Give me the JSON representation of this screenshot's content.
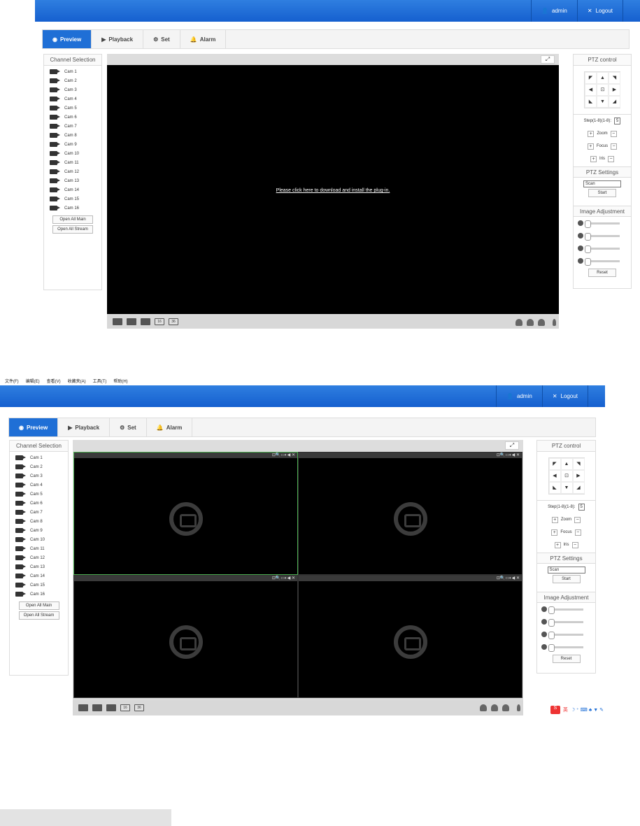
{
  "screen1": {
    "header": {
      "user_label": "admin",
      "logout_label": "Logout"
    },
    "tabs": [
      {
        "label": "Preview",
        "icon": "preview-icon",
        "active": true
      },
      {
        "label": "Playback",
        "icon": "playback-icon"
      },
      {
        "label": "Set",
        "icon": "gear-icon"
      },
      {
        "label": "Alarm",
        "icon": "bell-icon"
      }
    ],
    "channel_panel": {
      "title": "Channel Selection",
      "cams": [
        "Cam 1",
        "Cam 2",
        "Cam 3",
        "Cam 4",
        "Cam 5",
        "Cam 6",
        "Cam 7",
        "Cam 8",
        "Cam 9",
        "Cam 10",
        "Cam 11",
        "Cam 12",
        "Cam 13",
        "Cam 14",
        "Cam 15",
        "Cam 16"
      ],
      "open_all_main": "Open All Main",
      "open_all_stream": "Open All Stream"
    },
    "plugin_message": "Please click here to download and install the plug-in.",
    "ptz": {
      "title": "PTZ control",
      "step_label": "Step(1-8)(1-8):",
      "step_value": "5",
      "zoom_label": "Zoom",
      "focus_label": "Focus",
      "iris_label": "Iris"
    },
    "ptz_settings": {
      "title": "PTZ Settings",
      "mode": "Scan",
      "start_label": "Start"
    },
    "image_adjust": {
      "title": "Image Adjustment",
      "reset_label": "Reset"
    }
  },
  "screen2": {
    "menu": [
      "文件(F)",
      "编辑(E)",
      "查看(V)",
      "收藏夹(A)",
      "工具(T)",
      "帮助(H)"
    ],
    "tile_tools": "⊡🔍▭◐◀ ✕"
  },
  "colors": {
    "accent": "#1f6fd6",
    "selected_tile": "#4caf50"
  }
}
